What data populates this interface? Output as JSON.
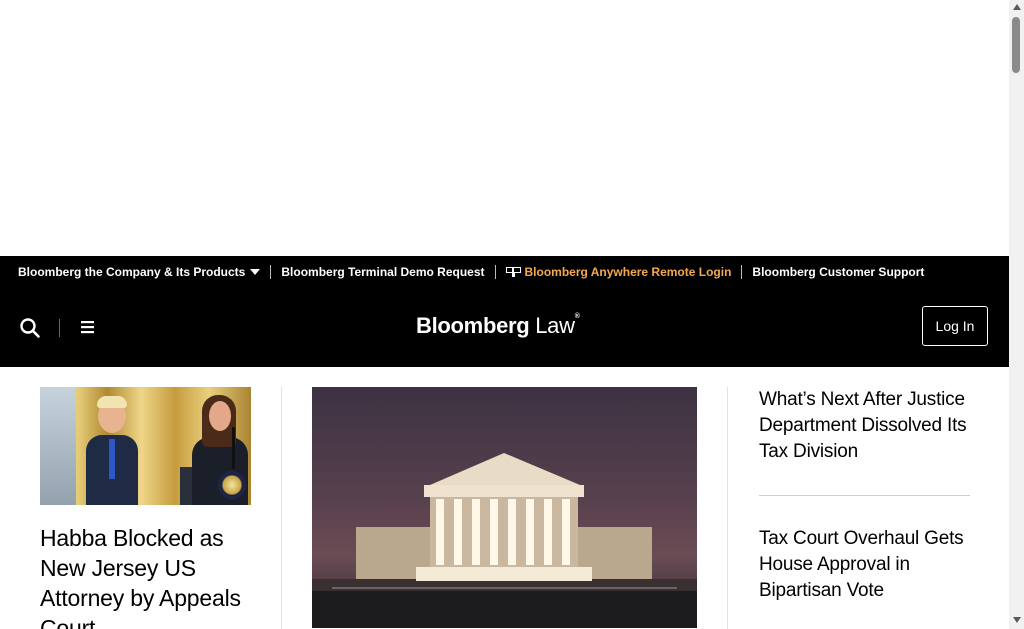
{
  "top_bar": {
    "items": [
      {
        "label": "Bloomberg the Company & Its Products",
        "has_dropdown": true
      },
      {
        "label": "Bloomberg Terminal Demo Request"
      },
      {
        "label": "Bloomberg Anywhere Remote Login",
        "icon": "terminal-icon",
        "color": "#f5a94f"
      },
      {
        "label": "Bloomberg Customer Support"
      }
    ]
  },
  "header": {
    "logo_main": "Bloomberg",
    "logo_sub": "Law",
    "logo_mark": "®",
    "login_label": "Log In",
    "icons": [
      "search-icon",
      "menu-icon"
    ]
  },
  "left_story": {
    "headline": "Habba Blocked as New Jersey US Attorney by Appeals Court"
  },
  "right_stories": [
    {
      "headline": "What’s Next After Justice Department Dissolved Its Tax Division"
    },
    {
      "headline": "Tax Court Overhaul Gets House Approval in Bipartisan Vote"
    }
  ],
  "colors": {
    "nav_background": "#000000",
    "accent_orange": "#f5a94f",
    "page_background": "#ffffff"
  }
}
